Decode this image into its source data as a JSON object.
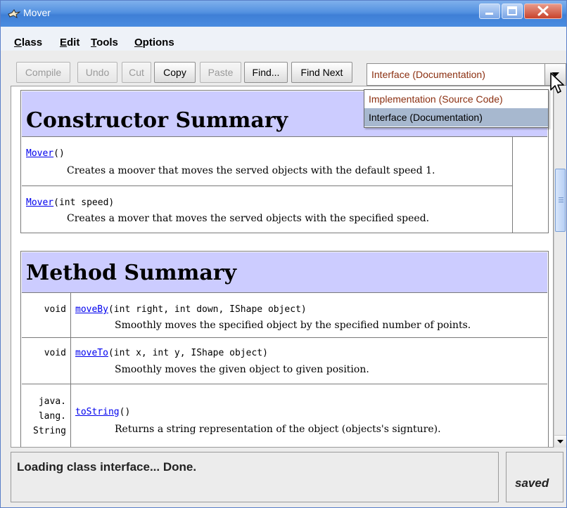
{
  "window": {
    "title": "Mover"
  },
  "menu": [
    {
      "mnemonic": "C",
      "rest": "lass"
    },
    {
      "mnemonic": "E",
      "rest": "dit"
    },
    {
      "mnemonic": "T",
      "rest": "ools"
    },
    {
      "mnemonic": "O",
      "rest": "ptions"
    }
  ],
  "toolbar": {
    "buttons": [
      {
        "label": "Compile",
        "enabled": false
      },
      {
        "label": "Undo",
        "enabled": false
      },
      {
        "label": "Cut",
        "enabled": false
      },
      {
        "label": "Copy",
        "enabled": true
      },
      {
        "label": "Paste",
        "enabled": false
      },
      {
        "label": "Find...",
        "enabled": true
      },
      {
        "label": "Find Next",
        "enabled": true
      }
    ],
    "view_select": {
      "selected": "Interface (Documentation)",
      "options": [
        "Implementation (Source Code)",
        "Interface (Documentation)"
      ]
    }
  },
  "constructor_summary": {
    "title": "Constructor Summary",
    "rows": [
      {
        "name": "Mover",
        "params": "()",
        "description": "Creates a moover that moves the served objects with the default speed 1."
      },
      {
        "name": "Mover",
        "params": "(int speed)",
        "description": "Creates a mover that moves the served objects with the specified speed."
      }
    ]
  },
  "method_summary": {
    "title": "Method Summary",
    "rows": [
      {
        "type": "void",
        "name": "moveBy",
        "params": "(int right, int down, IShape object)",
        "description": "Smoothly moves the specified object by the specified number of points."
      },
      {
        "type": "void",
        "name": "moveTo",
        "params": "(int x, int y, IShape object)",
        "description": "Smoothly moves the given object to given position."
      },
      {
        "type_lines": [
          "java.",
          "lang.",
          "String"
        ],
        "name": "toString",
        "params": "()",
        "description": "Returns a string representation of the object (objects's signture)."
      }
    ]
  },
  "status": {
    "message": "Loading class interface... Done.",
    "saved_label": "saved"
  },
  "colors": {
    "summary_header": "#ccccff",
    "link": "#0000ee",
    "select_text": "#8b2f10",
    "selected_option": "#a7b8cf"
  },
  "icons": {
    "app": "bird-icon",
    "minimize": "minimize-icon",
    "maximize": "maximize-icon",
    "close": "close-icon",
    "dropdown": "chevron-down-icon",
    "cursor": "mouse-pointer-icon"
  }
}
